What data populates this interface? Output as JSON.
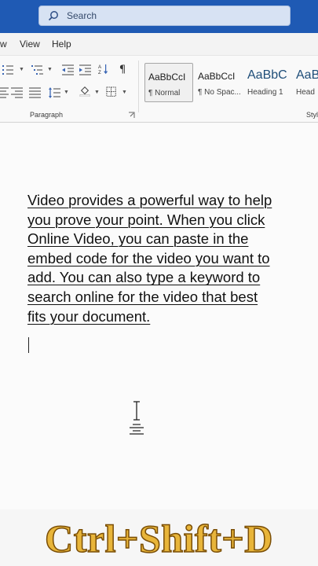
{
  "titlebar": {
    "search_placeholder": "Search"
  },
  "tabs": {
    "view": "View",
    "help": "Help",
    "partial": "w"
  },
  "ribbon": {
    "paragraph_label": "Paragraph",
    "styles_label": "Styl",
    "styles": [
      {
        "sample": "AaBbCcI",
        "name": "¶ Normal"
      },
      {
        "sample": "AaBbCcI",
        "name": "¶ No Spac..."
      },
      {
        "sample": "AaBbC",
        "name": "Heading 1"
      },
      {
        "sample": "AaBl",
        "name": "Head"
      }
    ]
  },
  "document": {
    "lines": [
      "Video provides a powerful way to help",
      "you prove your point. When you click",
      "Online Video, you can paste in the",
      "embed code for the video you want to",
      "add. You can also type a keyword to",
      "search online for the video that best",
      "fits your document."
    ]
  },
  "overlay": {
    "shortcut": "Ctrl+Shift+D"
  },
  "colors": {
    "titlebar": "#1f5ab4",
    "shortcut_fill": "#e8b53a",
    "heading_style": "#1f4e79"
  }
}
